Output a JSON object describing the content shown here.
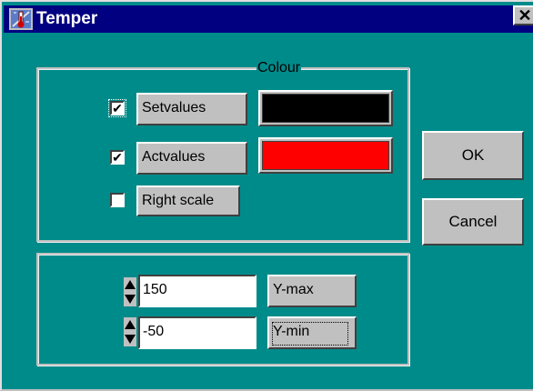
{
  "window": {
    "title": "Temper",
    "close_glyph": "✕"
  },
  "colour_group": {
    "legend": "Colour",
    "rows": [
      {
        "label": "Setvalues",
        "checked": true,
        "color": "#000000"
      },
      {
        "label": "Actvalues",
        "checked": true,
        "color": "#ff0000"
      },
      {
        "label": "Right scale",
        "checked": false
      }
    ]
  },
  "scale_group": {
    "ymax_value": "150",
    "ymax_label": "Y-max",
    "ymin_value": "-50",
    "ymin_label": "Y-min"
  },
  "buttons": {
    "ok": "OK",
    "cancel": "Cancel"
  },
  "icons": {
    "app": "thermometer-icon",
    "spinner": "spinner-arrows-icon",
    "close": "close-icon"
  },
  "colors": {
    "window_bg": "#008b8b",
    "titlebar": "#000080",
    "face": "#c0c0c0"
  }
}
